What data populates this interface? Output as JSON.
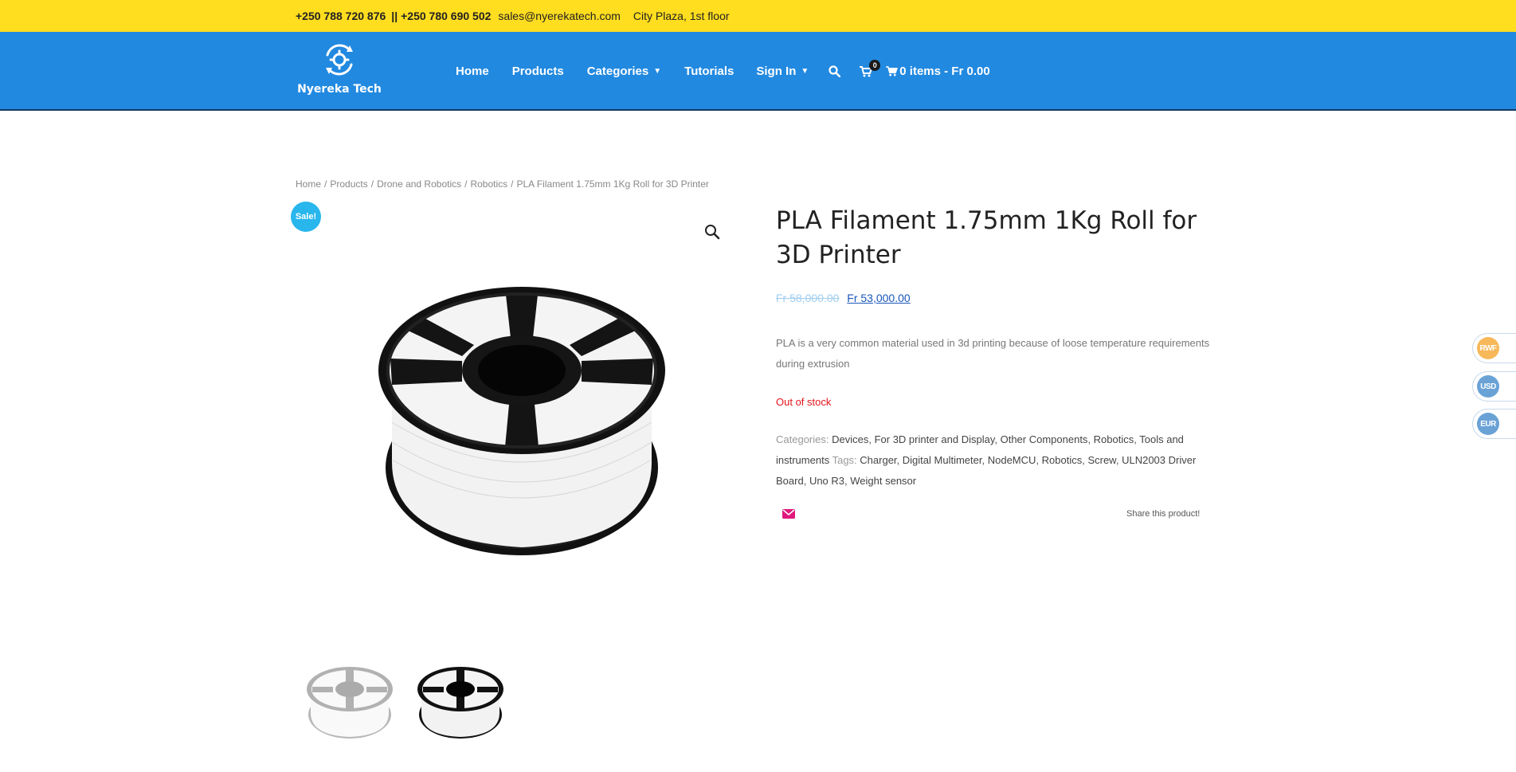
{
  "topbar": {
    "phone1": "+250 788 720 876",
    "separator": "||",
    "phone2": "+250 780 690 502",
    "email": "sales@nyerekatech.com",
    "address": "City Plaza, 1st floor"
  },
  "brand": {
    "name": "Nyereka Tech"
  },
  "nav": {
    "items": [
      "Home",
      "Products",
      "Categories",
      "Tutorials",
      "Sign In"
    ],
    "cart_count": "0",
    "cart_summary": "0 items - Fr 0.00"
  },
  "breadcrumb": [
    "Home",
    "Products",
    "Drone and Robotics",
    "Robotics",
    "PLA Filament 1.75mm 1Kg Roll for 3D Printer"
  ],
  "product": {
    "sale_badge": "Sale!",
    "title": "PLA Filament 1.75mm 1Kg Roll for 3D Printer",
    "old_price": "Fr 58,000.00",
    "new_price": "Fr 53,000.00",
    "description": "PLA is a very common material used in 3d printing because of loose temperature requirements during extrusion",
    "stock": "Out of stock",
    "categories_label": "Categories:",
    "categories": [
      "Devices",
      "For 3D printer and Display",
      "Other Components",
      "Robotics",
      "Tools and instruments"
    ],
    "tags_label": "Tags:",
    "tags": [
      "Charger",
      "Digital Multimeter",
      "NodeMCU",
      "Robotics",
      "Screw",
      "ULN2003 Driver Board",
      "Uno R3",
      "Weight sensor"
    ],
    "share_text": "Share this product!"
  },
  "currencies": [
    {
      "code": "RWF",
      "color": "#f7b85a"
    },
    {
      "code": "USD",
      "color": "#6aa2d6"
    },
    {
      "code": "EUR",
      "color": "#6aa2d6"
    }
  ],
  "colors": {
    "topbar": "#ffdd1f",
    "navbar": "#2289e0",
    "sale": "#28b6ec",
    "out_of_stock": "#e2141c",
    "share_icon": "#e0197d"
  }
}
